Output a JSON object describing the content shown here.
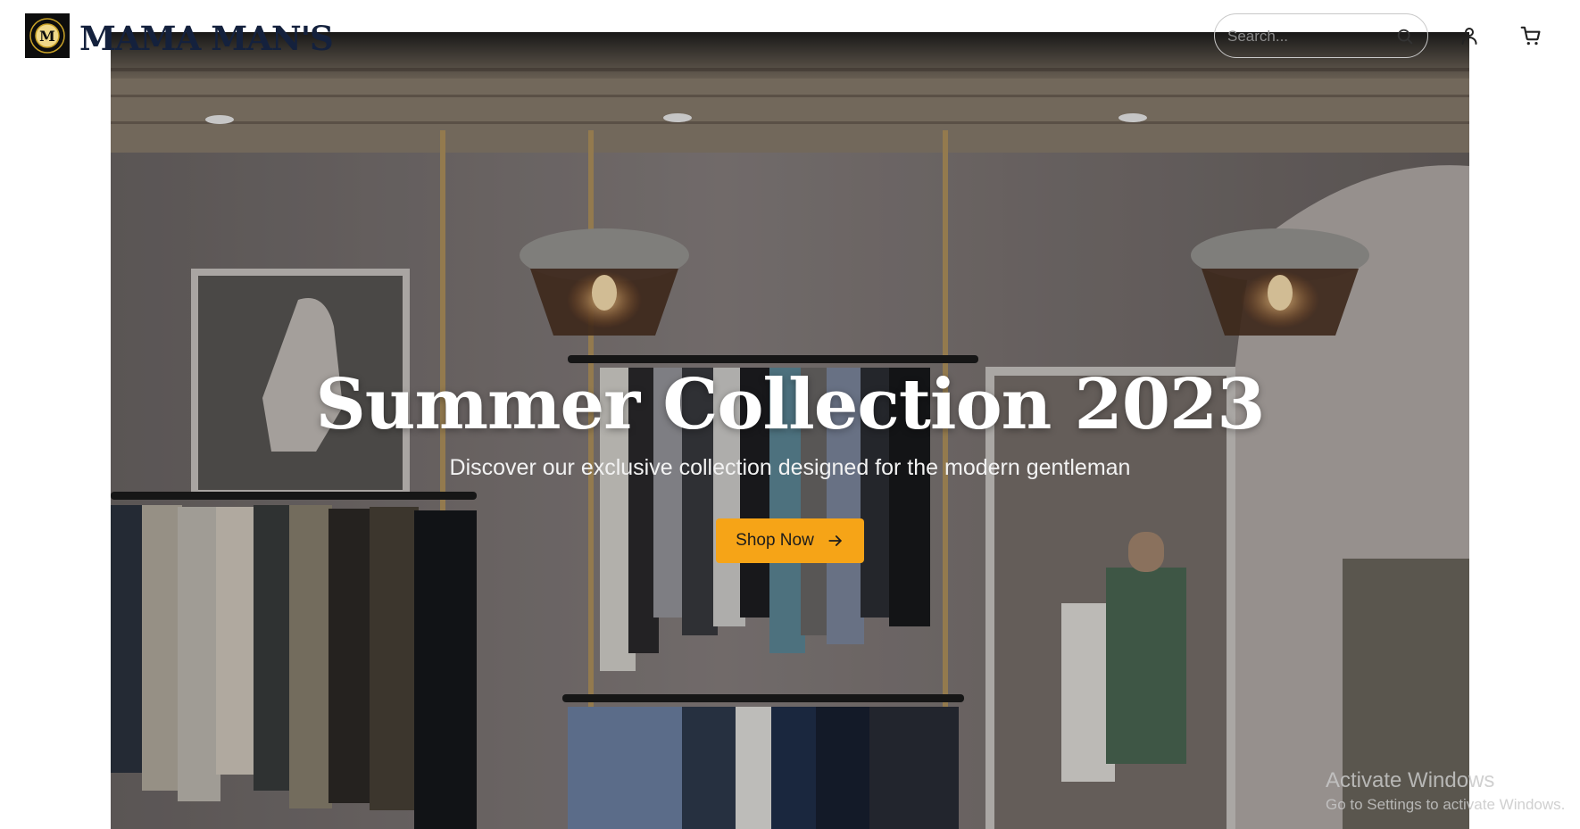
{
  "brand": {
    "name": "MAMA MAN'S",
    "logo_letter": "M",
    "colors": {
      "name": "#14213d",
      "badge": "#0d0d0d",
      "badge_accent": "#c9a227"
    }
  },
  "header": {
    "search": {
      "placeholder": "Search...",
      "value": "",
      "icon": "search-icon"
    },
    "icons": [
      "user-icon",
      "cart-icon"
    ]
  },
  "hero": {
    "title": "Summer Collection 2023",
    "subtitle": "Discover our exclusive collection designed for the modern gentleman",
    "cta": {
      "label": "Shop Now",
      "icon": "arrow-right-icon",
      "color": "#f6a417"
    },
    "background": "photo of menswear store interior with hanging clothes racks and pendant lamps"
  },
  "watermark": {
    "title": "Activate Windows",
    "subtitle": "Go to Settings to activate Windows."
  }
}
